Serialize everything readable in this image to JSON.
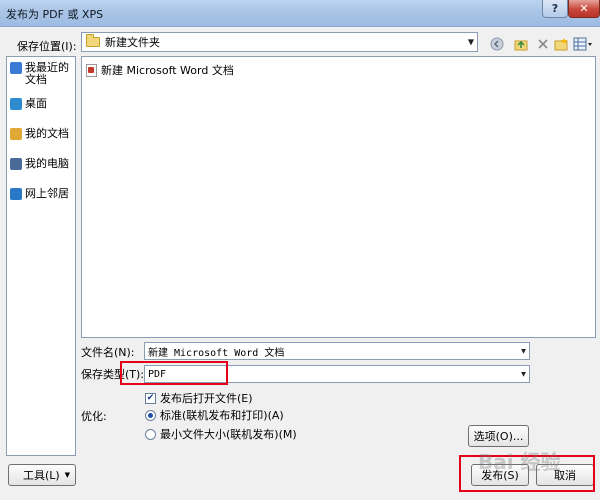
{
  "window": {
    "title": "发布为 PDF 或 XPS",
    "help_label": "?",
    "close_label": "✕"
  },
  "location": {
    "label": "保存位置(I):",
    "value": "新建文件夹"
  },
  "places": [
    {
      "label": "我最近的文档",
      "icon": "recent-documents-icon",
      "color": "#3a7bd5"
    },
    {
      "label": "桌面",
      "icon": "desktop-icon",
      "color": "#2f8bd0"
    },
    {
      "label": "我的文档",
      "icon": "my-documents-icon",
      "color": "#e0a935"
    },
    {
      "label": "我的电脑",
      "icon": "my-computer-icon",
      "color": "#4a6a9a"
    },
    {
      "label": "网上邻居",
      "icon": "network-icon",
      "color": "#2a78c8"
    }
  ],
  "files": [
    {
      "name": "新建 Microsoft Word 文档"
    }
  ],
  "filename": {
    "label": "文件名(N):",
    "value": "新建 Microsoft Word 文档"
  },
  "filetype": {
    "label": "保存类型(T):",
    "value": "PDF"
  },
  "open_after": {
    "label": "发布后打开文件(E)",
    "checked": true
  },
  "optimize": {
    "label": "优化:",
    "options": [
      {
        "label": "标准(联机发布和打印)(A)",
        "selected": true
      },
      {
        "label": "最小文件大小(联机发布)(M)",
        "selected": false
      }
    ]
  },
  "buttons": {
    "options": "选项(O)...",
    "tools": "工具(L)",
    "publish": "发布(S)",
    "cancel": "取消"
  },
  "watermark": "Bai 经验",
  "colors": {
    "highlight_red": "#e4001b",
    "title_bar": "#a9c4e6"
  }
}
